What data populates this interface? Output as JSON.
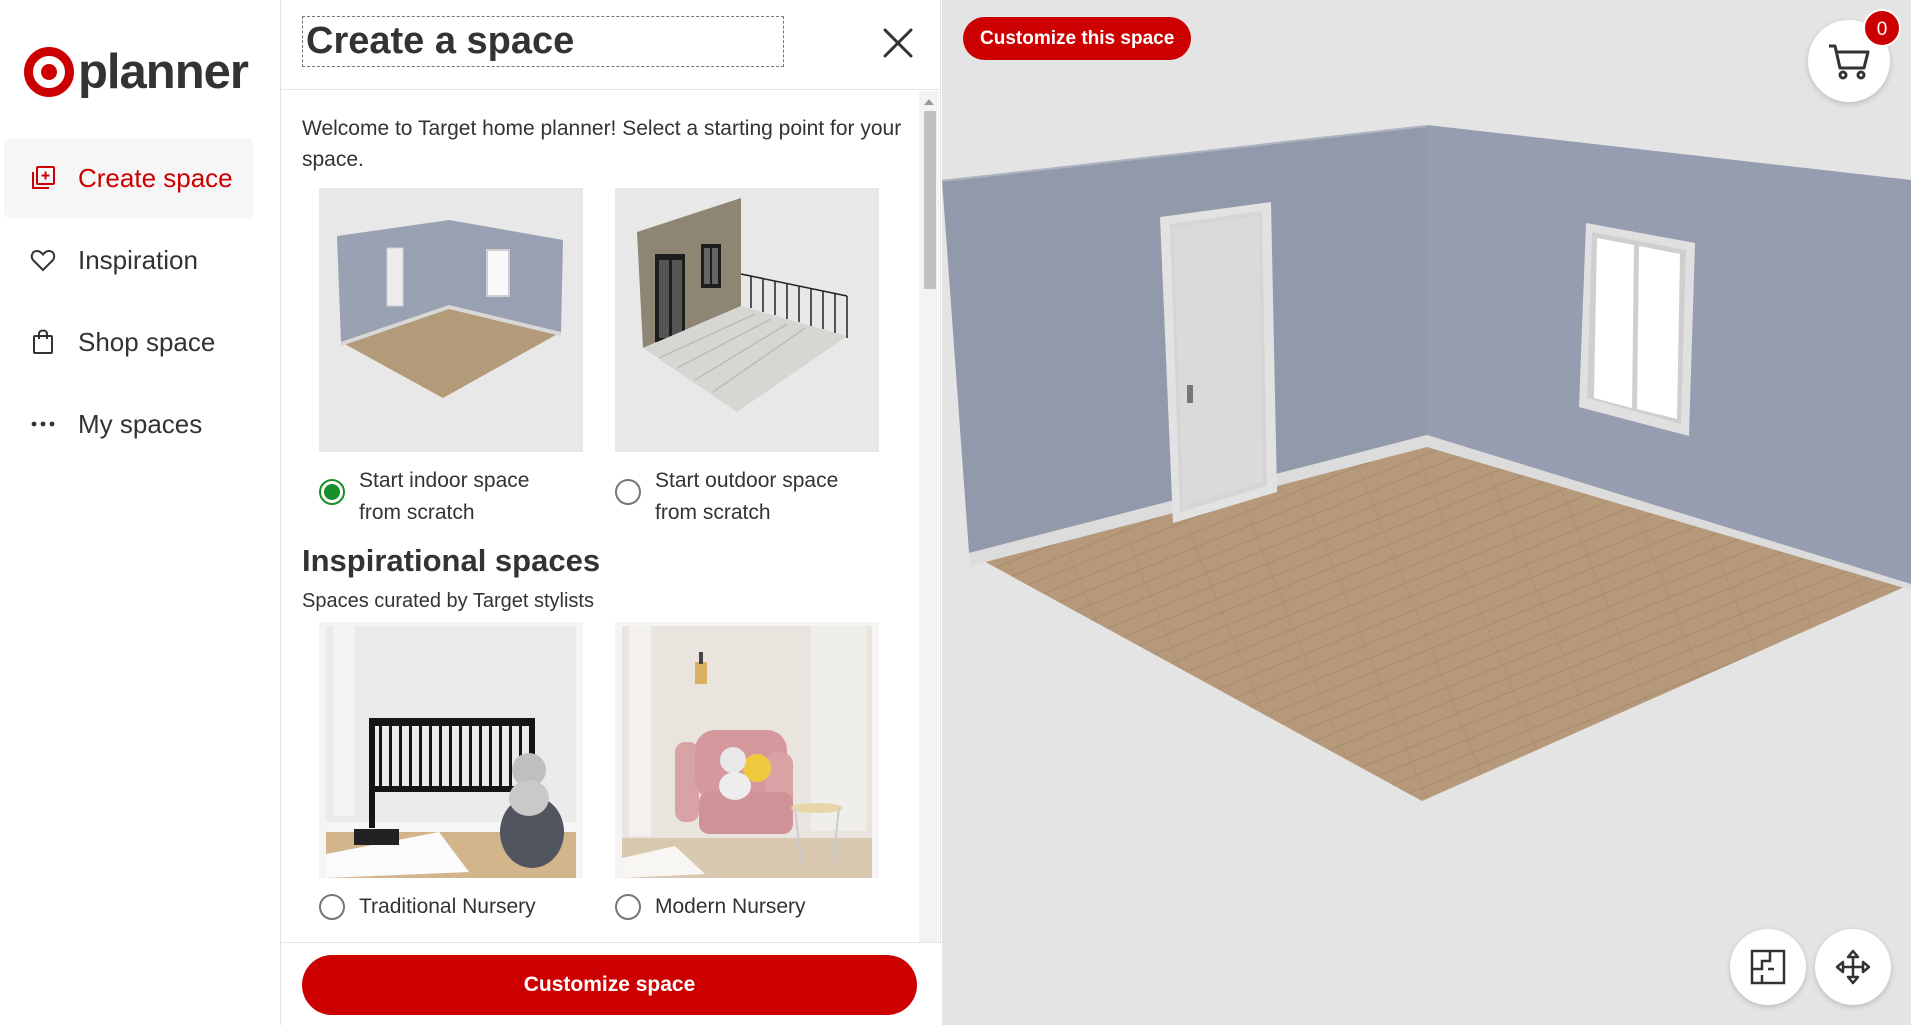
{
  "brand": {
    "name": "planner"
  },
  "nav": {
    "items": [
      {
        "label": "Create space",
        "icon": "add-box-icon",
        "active": true
      },
      {
        "label": "Inspiration",
        "icon": "heart-icon",
        "active": false
      },
      {
        "label": "Shop space",
        "icon": "shopping-bag-icon",
        "active": false
      },
      {
        "label": "My spaces",
        "icon": "more-horizontal-icon",
        "active": false
      }
    ]
  },
  "panel": {
    "title": "Create a space",
    "close_icon": "close-icon",
    "intro": "Welcome to Target home planner! Select a starting point for your space.",
    "starting_points": [
      {
        "line1": "Start indoor space",
        "line2": "from scratch",
        "selected": true
      },
      {
        "line1": "Start outdoor space",
        "line2": "from scratch",
        "selected": false
      }
    ],
    "inspiration": {
      "title": "Inspirational spaces",
      "subtitle": "Spaces curated by Target stylists",
      "items": [
        {
          "label": "Traditional Nursery",
          "selected": false
        },
        {
          "label": "Modern Nursery",
          "selected": false
        }
      ]
    },
    "cta_label": "Customize space"
  },
  "viewport": {
    "customize_label": "Customize this space",
    "cart_count": "0",
    "cart_icon": "cart-icon",
    "floorplan_icon": "floorplan-icon",
    "move_icon": "move-arrows-icon"
  },
  "colors": {
    "brand_red": "#cc0000",
    "selected_green": "#198f2a",
    "wall_left": "#9199ab",
    "wall_right": "#959cb0",
    "floor": "#b39978",
    "viewport_bg": "#e4e4e4"
  }
}
